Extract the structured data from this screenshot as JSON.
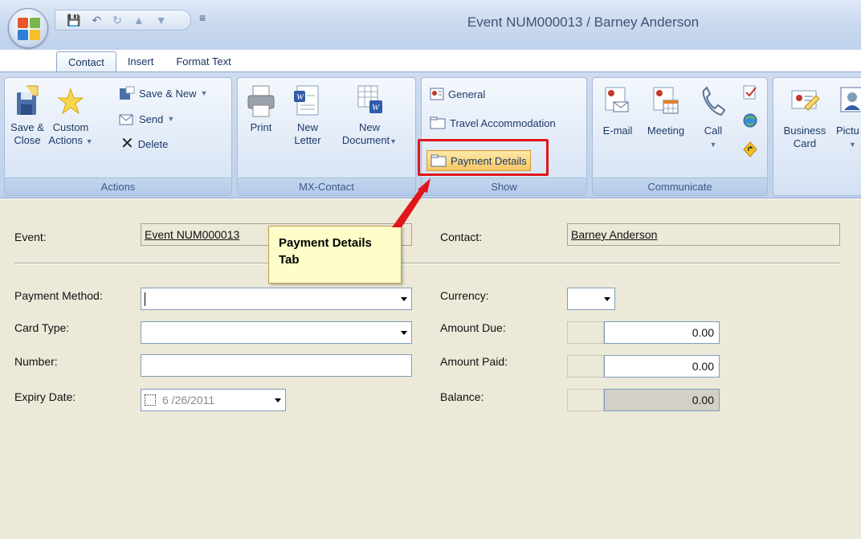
{
  "window": {
    "title": "Event NUM000013 / Barney Anderson"
  },
  "tabs": [
    {
      "label": "Contact"
    },
    {
      "label": "Insert"
    },
    {
      "label": "Format Text"
    }
  ],
  "ribbon": {
    "actions": {
      "group_label": "Actions",
      "save_close": [
        "Save &",
        "Close"
      ],
      "custom_actions": [
        "Custom",
        "Actions"
      ],
      "save_new": "Save & New",
      "send": "Send",
      "delete": "Delete"
    },
    "mx_contact": {
      "group_label": "MX-Contact",
      "print": "Print",
      "new_letter": [
        "New",
        "Letter"
      ],
      "new_document": [
        "New",
        "Document"
      ]
    },
    "show": {
      "group_label": "Show",
      "general": "General",
      "travel": "Travel Accommodation",
      "payment": "Payment Details"
    },
    "communicate": {
      "group_label": "Communicate",
      "email": "E-mail",
      "meeting": "Meeting",
      "call": "Call"
    },
    "more": {
      "business_card": [
        "Business",
        "Card"
      ],
      "picture": "Pictu"
    }
  },
  "callout": {
    "line1": "Payment Details",
    "line2": "Tab"
  },
  "form": {
    "event_label": "Event:",
    "event_value": "Event NUM000013",
    "contact_label": "Contact:",
    "contact_value": "Barney Anderson",
    "payment_method_label": "Payment Method:",
    "payment_method_value": "",
    "card_type_label": "Card Type:",
    "card_type_value": "",
    "number_label": "Number:",
    "number_value": "",
    "expiry_label": "Expiry Date:",
    "expiry_value": "6 /26/2011",
    "currency_label": "Currency:",
    "currency_value": "",
    "amount_due_label": "Amount Due:",
    "amount_due_value": "0.00",
    "amount_paid_label": "Amount Paid:",
    "amount_paid_value": "0.00",
    "balance_label": "Balance:",
    "balance_value": "0.00"
  },
  "colors": {
    "highlight": "#e1161c",
    "callout_bg": "#fefec8",
    "form_bg": "#ece9d8",
    "ribbon_text": "#1d3a67"
  }
}
